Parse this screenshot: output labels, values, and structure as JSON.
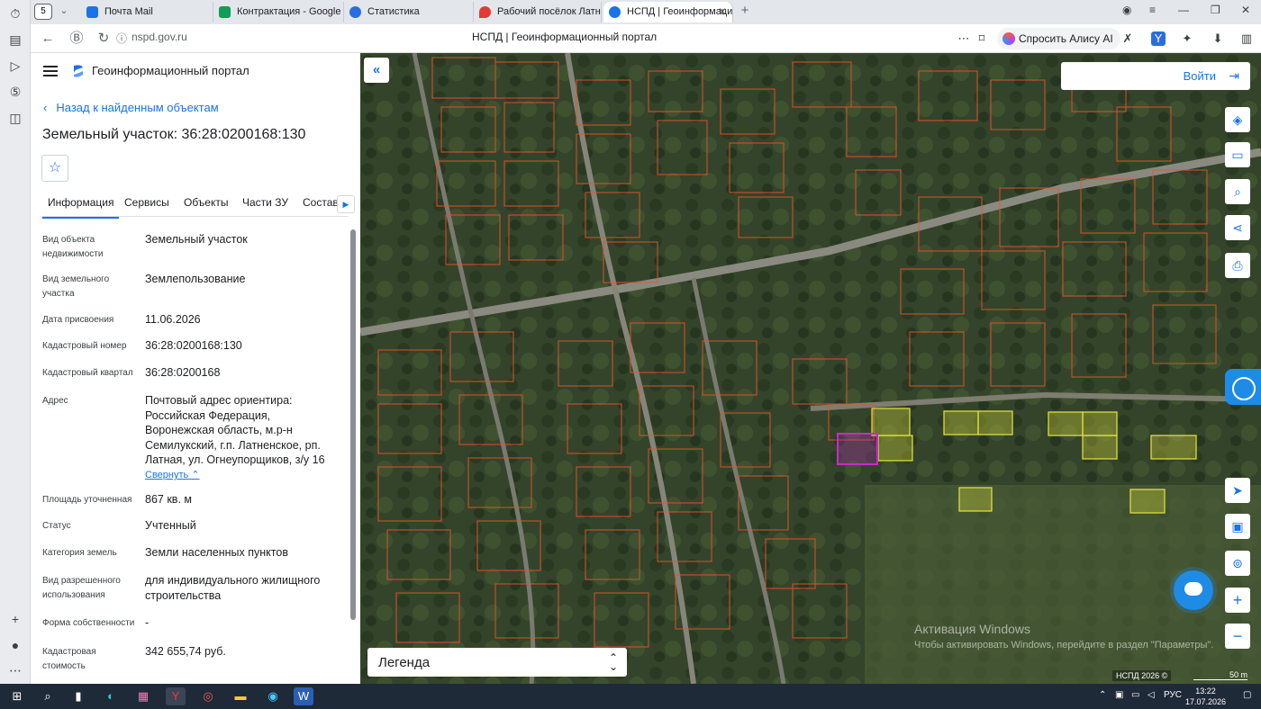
{
  "browser": {
    "tab_count": "5",
    "tabs": [
      {
        "label": "Почта Mail",
        "icon": "mail-icon",
        "color": "#1a73e8"
      },
      {
        "label": "Контрактация - Google Та",
        "icon": "sheets-icon",
        "color": "#0f9d58"
      },
      {
        "label": "Статистика",
        "icon": "yandex-icon",
        "color": "#2b6de0"
      },
      {
        "label": "Рабочий посёлок Латная",
        "icon": "map-pin-icon",
        "color": "#e53935"
      },
      {
        "label": "НСПД | Геоинформацио",
        "icon": "nspd-icon",
        "color": "#1a73e8"
      }
    ],
    "url": "nspd.gov.ru",
    "page_title": "НСПД | Геоинформационный портал",
    "alisa": "Спросить Алису AI"
  },
  "panel": {
    "portal_name": "Геоинформационный портал",
    "back_link": "Назад к найденным объектам",
    "object_title": "Земельный участок: 36:28:0200168:130",
    "tabs": [
      "Информация",
      "Сервисы",
      "Объекты",
      "Части ЗУ",
      "Состав"
    ],
    "fields": [
      {
        "label": "Вид объекта недвижимости",
        "value": "Земельный участок"
      },
      {
        "label": "Вид земельного участка",
        "value": "Землепользование"
      },
      {
        "label": "Дата присвоения",
        "value": "11.06.2026"
      },
      {
        "label": "Кадастровый номер",
        "value": "36:28:0200168:130"
      },
      {
        "label": "Кадастровый квартал",
        "value": "36:28:0200168"
      },
      {
        "label": "Адрес",
        "value": "Почтовый адрес ориентира: Российская Федерация, Воронежская область, м.р-н Семилукский, г.п. Латненское, рп. Латная, ул. Огнеупорщиков, з/у 16"
      },
      {
        "label": "Площадь уточненная",
        "value": "867 кв. м"
      },
      {
        "label": "Статус",
        "value": "Учтенный"
      },
      {
        "label": "Категория земель",
        "value": "Земли населенных пунктов"
      },
      {
        "label": "Вид разрешенного использования",
        "value": "для индивидуального жилищного строительства"
      },
      {
        "label": "Форма собственности",
        "value": "-"
      },
      {
        "label": "Кадастровая стоимость",
        "value": "342 655,74 руб."
      }
    ],
    "collapse_label": "Свернуть"
  },
  "map": {
    "login": "Войти",
    "legend": "Легенда",
    "watermark_title": "Активация Windows",
    "watermark_text": "Чтобы активировать Windows, перейдите в раздел \"Параметры\".",
    "attribution": "НСПД 2026 ©",
    "scale": "50 m",
    "colors": {
      "parcel": "#e8542a",
      "selected": "#c030c0",
      "highlight": "#e6e640"
    }
  },
  "taskbar": {
    "lang": "РУС",
    "time": "13:22",
    "date": "17.07.2026"
  }
}
